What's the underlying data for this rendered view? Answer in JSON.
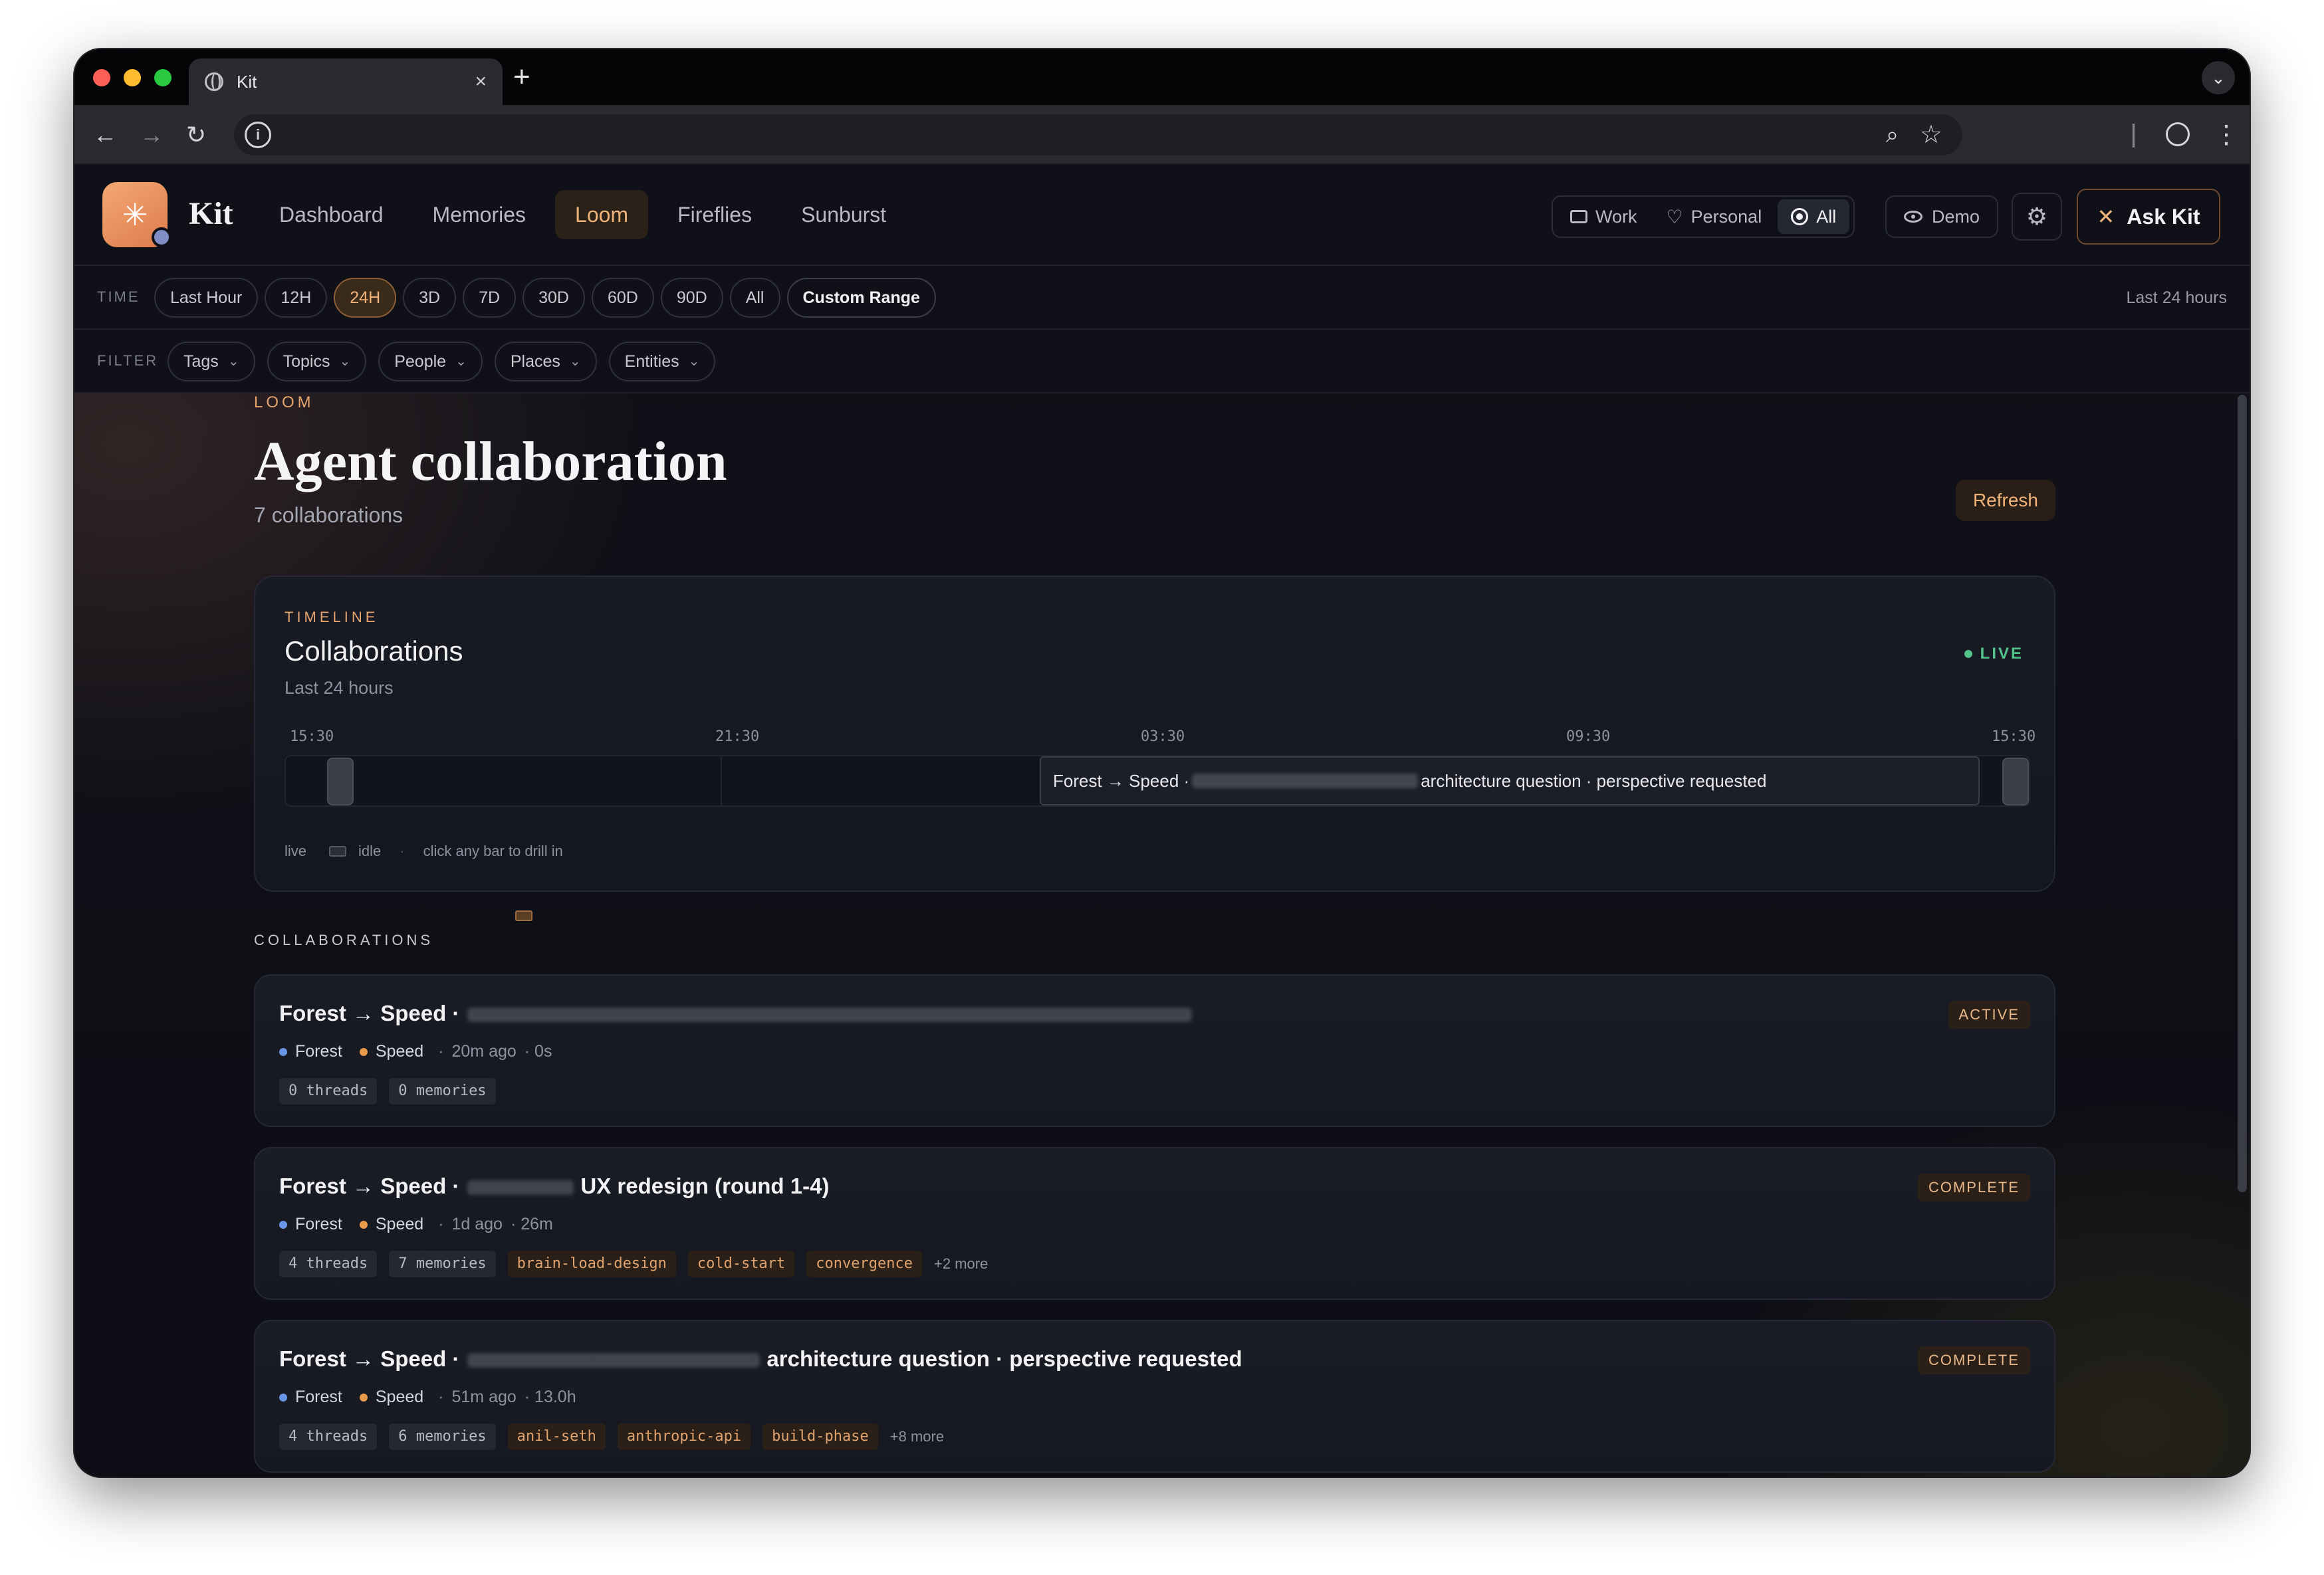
{
  "browser": {
    "tab_title": "Kit",
    "new_tab": "+",
    "tab_close": "×",
    "tab_menu": "⌄"
  },
  "app": {
    "brand": "Kit",
    "nav": [
      {
        "label": "Dashboard",
        "active": false
      },
      {
        "label": "Memories",
        "active": false
      },
      {
        "label": "Loom",
        "active": true
      },
      {
        "label": "Fireflies",
        "active": false
      },
      {
        "label": "Sunburst",
        "active": false
      }
    ],
    "scope": [
      {
        "label": "Work",
        "icon": "briefcase-icon",
        "active": false
      },
      {
        "label": "Personal",
        "icon": "heart-icon",
        "active": false
      },
      {
        "label": "All",
        "icon": "target-icon",
        "active": true
      }
    ],
    "demo_label": "Demo",
    "ask_label": "Ask Kit"
  },
  "time": {
    "label": "TIME",
    "options": [
      "Last Hour",
      "12H",
      "24H",
      "3D",
      "7D",
      "30D",
      "60D",
      "90D",
      "All",
      "Custom Range"
    ],
    "selected": "24H",
    "range_text": "Last 24 hours"
  },
  "filter": {
    "label": "FILTER",
    "options": [
      "Tags",
      "Topics",
      "People",
      "Places",
      "Entities"
    ]
  },
  "page": {
    "eyebrow": "LOOM",
    "title": "Agent collaboration",
    "subtitle": "7 collaborations",
    "refresh_label": "Refresh"
  },
  "timeline": {
    "eyebrow": "TIMELINE",
    "title": "Collaborations",
    "subtitle": "Last 24 hours",
    "live_label": "LIVE",
    "ticks": [
      "15:30",
      "21:30",
      "03:30",
      "09:30",
      "15:30"
    ],
    "bar_prefix": "Forest → Speed ·",
    "bar_suffix": "architecture question · perspective requested",
    "legend_live": "live",
    "legend_idle": "idle",
    "legend_hint": "click any bar to drill in"
  },
  "collaborations": {
    "label": "COLLABORATIONS",
    "items": [
      {
        "title_prefix": "Forest → Speed ·",
        "title_suffix": "",
        "agent_a": "Forest",
        "agent_b": "Speed",
        "ago": "20m ago",
        "duration": "· 0s",
        "tags": [
          "0 threads",
          "0 memories"
        ],
        "warm_tags": [],
        "more": "",
        "status": "ACTIVE"
      },
      {
        "title_prefix": "Forest → Speed ·",
        "title_suffix": "UX redesign (round 1-4)",
        "agent_a": "Forest",
        "agent_b": "Speed",
        "ago": "1d ago",
        "duration": "· 26m",
        "tags": [
          "4 threads",
          "7 memories"
        ],
        "warm_tags": [
          "brain-load-design",
          "cold-start",
          "convergence"
        ],
        "more": "+2 more",
        "status": "COMPLETE"
      },
      {
        "title_prefix": "Forest → Speed ·",
        "title_suffix": "architecture question · perspective requested",
        "agent_a": "Forest",
        "agent_b": "Speed",
        "ago": "51m ago",
        "duration": "· 13.0h",
        "tags": [
          "4 threads",
          "6 memories"
        ],
        "warm_tags": [
          "anil-seth",
          "anthropic-api",
          "build-phase"
        ],
        "more": "+8 more",
        "status": "COMPLETE"
      }
    ]
  }
}
